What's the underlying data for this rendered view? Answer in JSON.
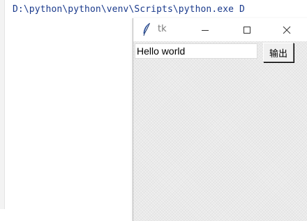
{
  "console": {
    "command_line": "D:\\python\\python\\venv\\Scripts\\python.exe D"
  },
  "tk_window": {
    "title": "tk",
    "icons": {
      "app": "feather-icon",
      "minimize": "minimize-icon",
      "maximize": "maximize-icon",
      "close": "close-icon"
    },
    "entry": {
      "value": "Hello world"
    },
    "button": {
      "label": "输出"
    }
  }
}
